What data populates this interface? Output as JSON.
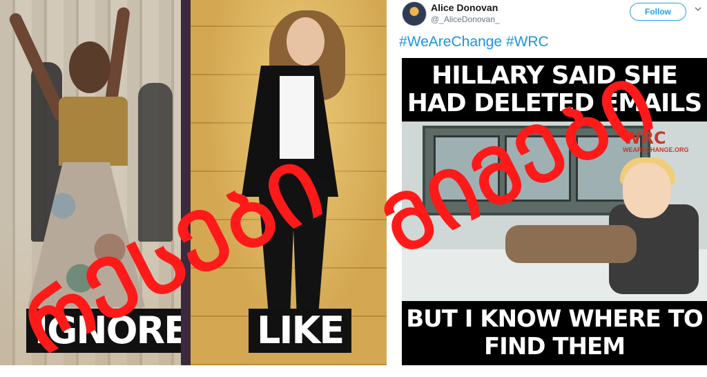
{
  "collage": {
    "left_caption": "IGNORE",
    "right_caption": "LIKE",
    "stamp_word_1": "ᲠᲔᲡᲔᲑᲘ",
    "stamp_word_2": "ᲛᲘᲛᲔᲑᲘ",
    "stamp_color": "#ff1a1a"
  },
  "tweet": {
    "author_name": "Alice Donovan",
    "author_handle": "@_AliceDonovan_",
    "follow_label": "Follow",
    "hashtags": [
      "#WeAreChange",
      "#WRC"
    ],
    "accent_color": "#1da1f2",
    "meme": {
      "top_text": "HILLARY  SAID SHE HAD DELETED EMAILS",
      "bottom_text": "BUT I KNOW WHERE TO FIND THEM",
      "logo_text": "WRC",
      "logo_subtext": "WEARECHANGE.ORG"
    }
  }
}
